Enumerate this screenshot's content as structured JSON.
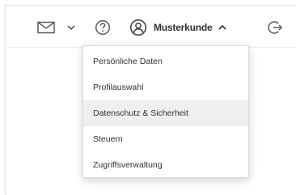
{
  "header": {
    "mail_icon": "envelope-icon",
    "mail_menu_icon": "chevron-down-icon",
    "help_icon": "question-circle-icon",
    "account_icon": "user-circle-icon",
    "account_name": "Musterkunde",
    "account_menu_icon": "chevron-up-icon",
    "logout_icon": "logout-icon"
  },
  "account_menu": {
    "items": [
      {
        "label": "Persönliche Daten"
      },
      {
        "label": "Profilauswahl"
      },
      {
        "label": "Datenschutz & Sicherheit",
        "active": true
      },
      {
        "label": "Steuern"
      },
      {
        "label": "Zugriffsverwaltung"
      }
    ]
  },
  "colors": {
    "text": "#303030",
    "icon": "#5a5a5a",
    "hover_background": "#efefef",
    "border": "#d9d9d9"
  }
}
